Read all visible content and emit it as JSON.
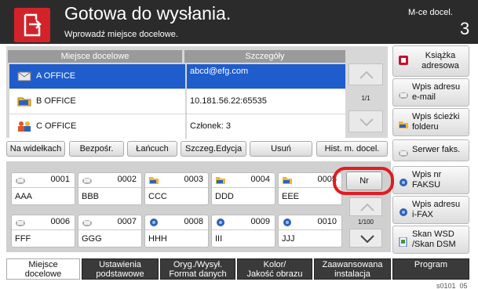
{
  "header": {
    "title": "Gotowa do wysłania.",
    "subtitle": "Wprowadź miejsce docelowe.",
    "count_label": "M-ce docel.",
    "count_value": "3"
  },
  "table": {
    "columns": [
      "Miejsce docelowe",
      "Szczegóły"
    ],
    "rows": [
      {
        "name": "A OFFICE",
        "detail": "abcd@efg.com",
        "icon": "email-icon",
        "selected": true
      },
      {
        "name": "B OFFICE",
        "detail": "10.181.56.22:65535",
        "icon": "folder-icon",
        "selected": false
      },
      {
        "name": "C OFFICE",
        "detail": "Członek:   3",
        "icon": "group-icon",
        "selected": false
      }
    ],
    "page": "1/1"
  },
  "right_buttons": [
    {
      "label_1": "Książka",
      "label_2": "adresowa",
      "icon": "address-book-icon"
    },
    {
      "label_1": "Wpis adresu",
      "label_2": "e-mail",
      "icon": "email-entry-icon"
    },
    {
      "label_1": "Wpis ścieżki",
      "label_2": "folderu",
      "icon": "folder-path-icon"
    },
    {
      "label_1": "Serwer faks.",
      "label_2": "",
      "icon": "fax-server-icon"
    },
    {
      "label_1": "Wpis nr",
      "label_2": "FAKSU",
      "icon": "fax-number-icon"
    },
    {
      "label_1": "Wpis adresu",
      "label_2": "i-FAX",
      "icon": "ifax-icon"
    },
    {
      "label_1": "Skan WSD",
      "label_2": "/Skan DSM",
      "icon": "wsd-scan-icon"
    }
  ],
  "toolbar": {
    "hook": "Na widełkach",
    "direct": "Bezpośr.",
    "chain": "Łańcuch",
    "detail_edit": "Szczeg.Edycja",
    "delete": "Usuń",
    "history": "Hist. m. docel."
  },
  "speed_dial": {
    "nr_label": "Nr",
    "page": "1/100",
    "items": [
      {
        "num": "0001",
        "name": "AAA",
        "icon": "email-icon"
      },
      {
        "num": "0002",
        "name": "BBB",
        "icon": "email-icon"
      },
      {
        "num": "0003",
        "name": "CCC",
        "icon": "folder-icon"
      },
      {
        "num": "0004",
        "name": "DDD",
        "icon": "folder-icon"
      },
      {
        "num": "0005",
        "name": "EEE",
        "icon": "folder-icon"
      },
      {
        "num": "0006",
        "name": "FFF",
        "icon": "email-icon"
      },
      {
        "num": "0007",
        "name": "GGG",
        "icon": "email-icon"
      },
      {
        "num": "0008",
        "name": "HHH",
        "icon": "fax-icon"
      },
      {
        "num": "0009",
        "name": "III",
        "icon": "fax-icon"
      },
      {
        "num": "0010",
        "name": "JJJ",
        "icon": "fax-icon"
      }
    ]
  },
  "tabs": [
    {
      "line_1": "Miejsce",
      "line_2": "docelowe",
      "active": true
    },
    {
      "line_1": "Ustawienia",
      "line_2": "podstawowe",
      "active": false
    },
    {
      "line_1": "Oryg./Wysył.",
      "line_2": "Format danych",
      "active": false
    },
    {
      "line_1": "Kolor/",
      "line_2": "Jakość obrazu",
      "active": false
    },
    {
      "line_1": "Zaawansowana",
      "line_2": "instalacja",
      "active": false
    },
    {
      "line_1": "Program",
      "line_2": "",
      "active": false
    }
  ],
  "footer_code": "s0101_05",
  "colors": {
    "accent_red": "#d2232a",
    "selected_blue": "#1f5ccc",
    "header_bg": "#2b2b2b"
  }
}
